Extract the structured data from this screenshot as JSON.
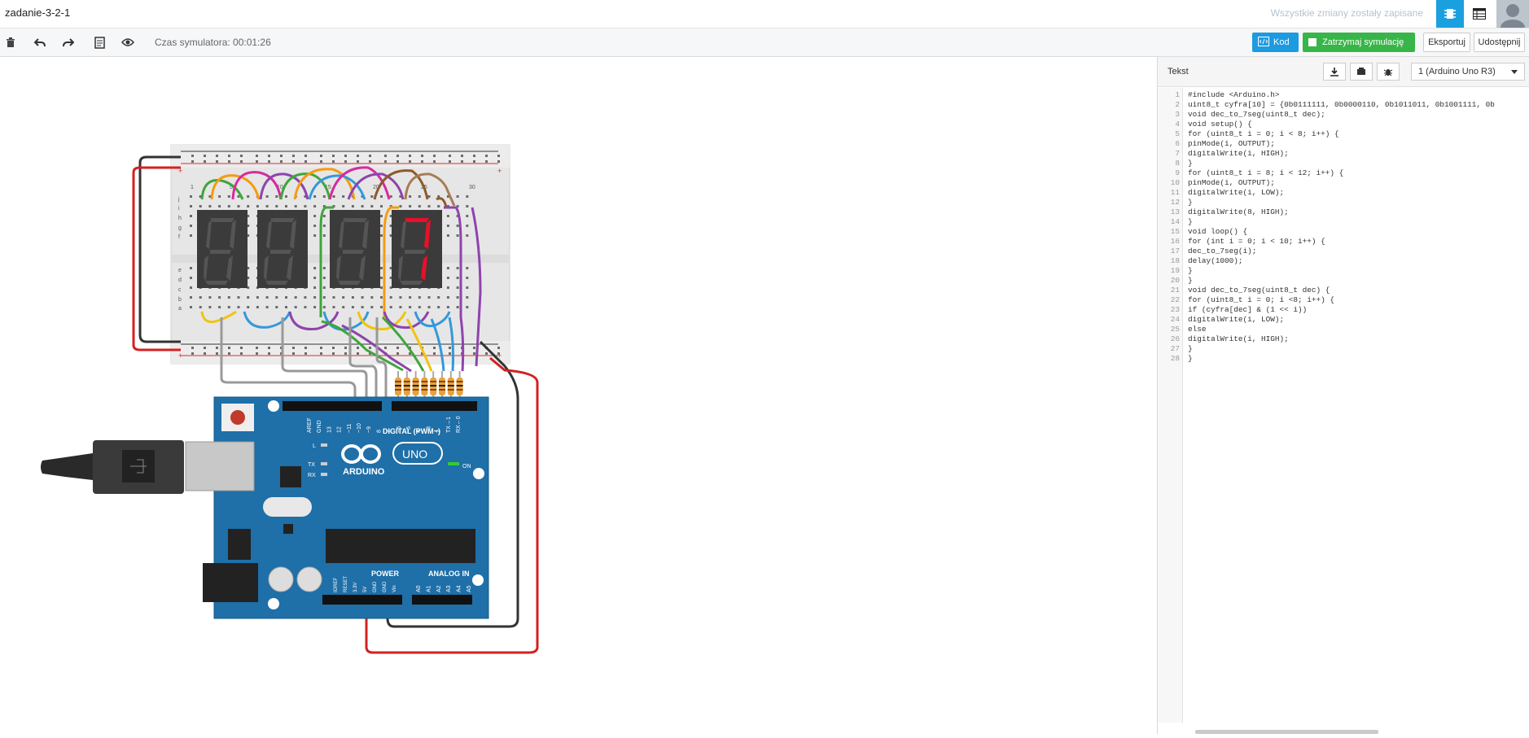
{
  "header": {
    "project_title": "zadanie-3-2-1",
    "save_status": "Wszystkie zmiany zostały zapisane",
    "icons": [
      "circuit-view-icon",
      "component-list-icon",
      "user-avatar-icon"
    ]
  },
  "toolbar": {
    "icons": [
      "trash-icon",
      "undo-icon",
      "redo-icon",
      "notes-icon",
      "eye-icon"
    ],
    "sim_time": "Czas symulatora: 00:01:26",
    "code_label": "Kod",
    "stop_label": "Zatrzymaj symulację",
    "export_label": "Eksportuj",
    "share_label": "Udostępnij"
  },
  "colors": {
    "accent_blue": "#1d9be0",
    "stop_green": "#37b548",
    "board_blue": "#1f6fa8",
    "wire_red": "#d42020",
    "wire_black": "#333333"
  },
  "circuit": {
    "breadboard_rows": [
      "j",
      "i",
      "h",
      "g",
      "f",
      "e",
      "d",
      "c",
      "b",
      "a"
    ],
    "breadboard_cols": [
      "1",
      "5",
      "10",
      "15",
      "20",
      "25",
      "30"
    ],
    "display_digit": "7",
    "arduino": {
      "brand": "ARDUINO",
      "model": "UNO",
      "digital_label": "DIGITAL (PWM~)",
      "power_label": "POWER",
      "analog_label": "ANALOG IN",
      "on_label": "ON",
      "led_labels": [
        "L",
        "TX",
        "RX"
      ],
      "digital_pins": [
        "AREF",
        "GND",
        "13",
        "12",
        "~11",
        "~10",
        "~9",
        "8",
        "7",
        "~6",
        "~5",
        "4",
        "~3",
        "2",
        "TX→1",
        "RX←0"
      ],
      "power_pins": [
        "IOREF",
        "RESET",
        "3.3V",
        "5V",
        "GND",
        "GND",
        "Vin"
      ],
      "analog_pins": [
        "A0",
        "A1",
        "A2",
        "A3",
        "A4",
        "A5"
      ]
    }
  },
  "panel": {
    "title": "Tekst",
    "icons": [
      "download-icon",
      "libraries-icon",
      "debugger-icon"
    ],
    "device_select": "1 (Arduino Uno R3)",
    "code_lines": [
      "#include <Arduino.h>",
      "uint8_t cyfra[10] = {0b0111111, 0b0000110, 0b1011011, 0b1001111, 0b",
      "void dec_to_7seg(uint8_t dec);",
      "void setup() {",
      "for (uint8_t i = 0; i < 8; i++) {",
      "pinMode(i, OUTPUT);",
      "digitalWrite(i, HIGH);",
      "}",
      "for (uint8_t i = 8; i < 12; i++) {",
      "pinMode(i, OUTPUT);",
      "digitalWrite(i, LOW);",
      "}",
      "digitalWrite(8, HIGH);",
      "}",
      "void loop() {",
      "for (int i = 0; i < 10; i++) {",
      "dec_to_7seg(i);",
      "delay(1000);",
      "}",
      "}",
      "void dec_to_7seg(uint8_t dec) {",
      "for (uint8_t i = 0; i <8; i++) {",
      "if (cyfra[dec] & (1 << i))",
      "digitalWrite(i, LOW);",
      "else",
      "digitalWrite(i, HIGH);",
      "}",
      "}"
    ],
    "line_numbers": [
      "1",
      "2",
      "3",
      "4",
      "5",
      "6",
      "7",
      "8",
      "9",
      "10",
      "11",
      "12",
      "13",
      "14",
      "15",
      "16",
      "17",
      "18",
      "19",
      "20",
      "21",
      "22",
      "23",
      "24",
      "25",
      "26",
      "27",
      "28"
    ]
  }
}
